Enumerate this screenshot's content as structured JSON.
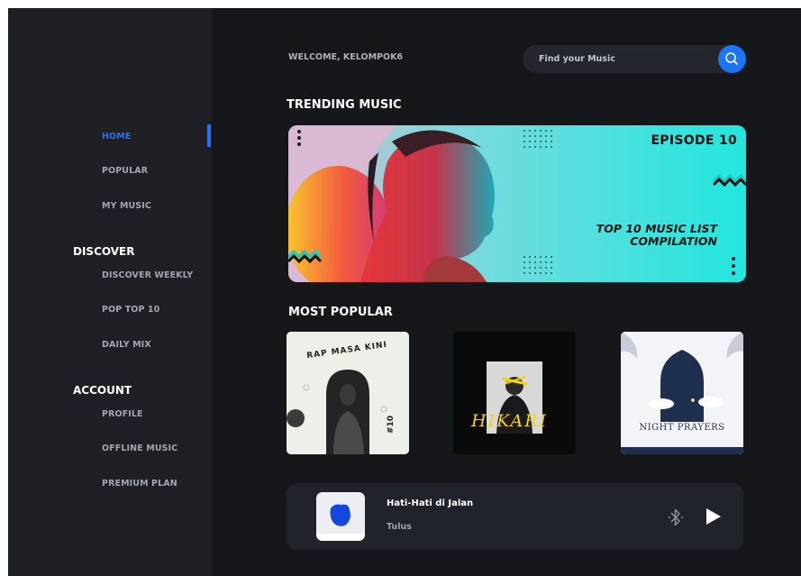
{
  "header": {
    "welcome": "WELCOME, KELOMPOK6",
    "search_placeholder": "Find your Music"
  },
  "sidebar": {
    "main_items": [
      {
        "label": "HOME",
        "active": true
      },
      {
        "label": "POPULAR"
      },
      {
        "label": "MY MUSIC"
      }
    ],
    "discover": {
      "heading": "DISCOVER",
      "items": [
        "DISCOVER WEEKLY",
        "POP TOP 10",
        "DAILY MIX"
      ]
    },
    "account": {
      "heading": "ACCOUNT",
      "items": [
        "PROFILE",
        "OFFLINE MUSIC",
        "PREMIUM PLAN"
      ]
    }
  },
  "trending": {
    "heading": "TRENDING MUSIC",
    "banner": {
      "episode": "EPISODE 10",
      "title_line1": "TOP 10 MUSIC LIST",
      "title_line2": "COMPILATION"
    }
  },
  "most_popular": {
    "heading": "MOST POPULAR",
    "albums": [
      {
        "title": "RAP MASA KINI",
        "number": "#10"
      },
      {
        "title": "HIKARI"
      },
      {
        "title": "NIGHT PRAYERS"
      }
    ]
  },
  "player": {
    "song": "Hati-Hati di Jalan",
    "artist": "Tulus"
  },
  "colors": {
    "accent": "#1d74f5",
    "active_nav": "#2e6ff0",
    "background": "#16171b",
    "sidebar": "#1e2025",
    "banner": "#22e6de"
  },
  "icons": [
    "search-icon",
    "bluetooth-icon",
    "play-icon"
  ]
}
